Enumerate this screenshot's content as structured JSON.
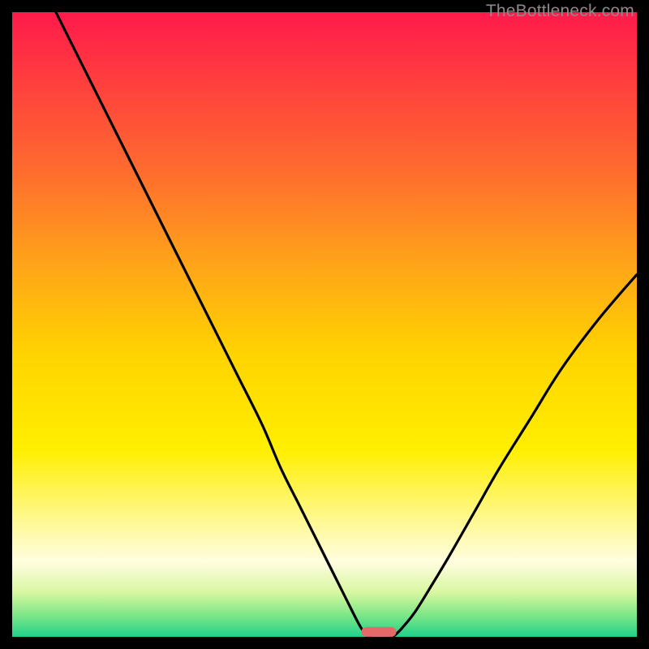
{
  "watermark": "TheBottleneck.com",
  "chart_data": {
    "type": "line",
    "title": "",
    "xlabel": "",
    "ylabel": "",
    "xlim": [
      0,
      100
    ],
    "ylim": [
      0,
      100
    ],
    "gradient_stops": [
      {
        "pos": 0.0,
        "color": "#ff1a4b"
      },
      {
        "pos": 0.1,
        "color": "#ff3b3f"
      },
      {
        "pos": 0.25,
        "color": "#ff6a2f"
      },
      {
        "pos": 0.4,
        "color": "#ffa319"
      },
      {
        "pos": 0.55,
        "color": "#ffd400"
      },
      {
        "pos": 0.7,
        "color": "#ffef00"
      },
      {
        "pos": 0.82,
        "color": "#fff99a"
      },
      {
        "pos": 0.88,
        "color": "#fffde0"
      },
      {
        "pos": 0.93,
        "color": "#d6f7a0"
      },
      {
        "pos": 0.965,
        "color": "#7ee787"
      },
      {
        "pos": 1.0,
        "color": "#1fd18b"
      }
    ],
    "series": [
      {
        "name": "left-curve",
        "x": [
          7,
          12,
          17,
          22,
          27,
          32,
          36,
          40,
          43,
          46,
          49,
          51.5,
          53.5,
          55,
          56,
          56.8,
          57.3
        ],
        "y": [
          100,
          90,
          80,
          70,
          60,
          50,
          42,
          34,
          27,
          21,
          15,
          10,
          6,
          3,
          1.2,
          0.3,
          0
        ]
      },
      {
        "name": "right-curve",
        "x": [
          60.5,
          61.3,
          62.5,
          64.5,
          67,
          70,
          74,
          78,
          83,
          88,
          94,
          100
        ],
        "y": [
          0,
          0.3,
          1.5,
          4,
          8,
          13,
          20,
          27,
          35,
          43,
          51,
          58
        ]
      }
    ],
    "marker": {
      "name": "bottleneck-marker",
      "x_center": 58.7,
      "x_halfwidth": 2.8,
      "y": 0.8,
      "color": "#e46a6a"
    }
  }
}
